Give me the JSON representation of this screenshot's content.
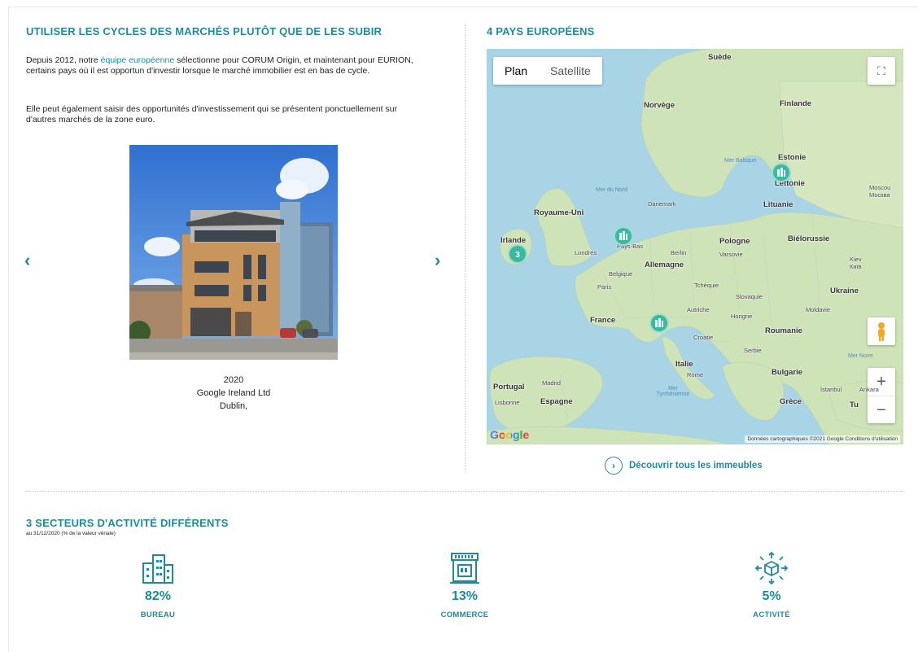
{
  "left": {
    "heading": "UTILISER LES CYCLES DES MARCHÉS PLUTÔT QUE DE LES SUBIR",
    "para1_start": "Depuis 2012, notre ",
    "para1_link": "équipe européenne",
    "para1_end": " sélectionne pour CORUM Origin, et maintenant pour EURION, certains pays où il est opportun d'investir lorsque le marché immobilier est en bas de cycle.",
    "para2": "Elle peut également saisir des opportunités d'investissement qui se présentent ponctuellement sur d'autres marchés de la zone euro.",
    "prev_arrow": "‹",
    "next_arrow": "›",
    "caption": {
      "year": "2020",
      "name": "Google Ireland Ltd",
      "city": "Dublin,"
    }
  },
  "right": {
    "heading": "4 PAYS EUROPÉENS",
    "map": {
      "tab_plan": "Plan",
      "tab_satellite": "Satellite",
      "fullscreen_glyph": "⛶",
      "zoom_in": "+",
      "zoom_out": "−",
      "google_logo": "Google",
      "attribution": "Données cartographiques ©2021 Google   Conditions d'utilisation",
      "labels": {
        "suede": "Suède",
        "norvege": "Norvège",
        "finlande": "Finlande",
        "estonie": "Estonie",
        "lettonie": "Lettonie",
        "lituanie": "Lituanie",
        "mer_baltique": "Mer Baltique",
        "mer_du_nord": "Mer du Nord",
        "danemark": "Danemark",
        "royaume_uni": "Royaume-Uni",
        "irlande": "Irlande",
        "londres": "Londres",
        "pays_bas": "Pays-Bas",
        "berlin": "Berlin",
        "pologne": "Pologne",
        "varsovie": "Varsovie",
        "bielorussie": "Biélorussie",
        "moscou": "Moscou Москва",
        "kiev": "Kiev Київ",
        "allemagne": "Allemagne",
        "belgique": "Belgique",
        "paris": "Paris",
        "tchequie": "Tchéquie",
        "slovaquie": "Slovaquie",
        "ukraine": "Ukraine",
        "autriche": "Autriche",
        "hongrie": "Hongrie",
        "moldavie": "Moldavie",
        "france": "France",
        "croatie": "Croatie",
        "roumanie": "Roumanie",
        "serbie": "Serbie",
        "mer_noire": "Mer Noire",
        "italie": "Italie",
        "rome": "Rome",
        "bulgarie": "Bulgarie",
        "portugal": "Portugal",
        "madrid": "Madrid",
        "lisbonne": "Lisbonne",
        "espagne": "Espagne",
        "mer_tyrrhenienne": "Mer Tyrrhénienne",
        "istanbul": "İstanbul",
        "ankara": "Ankara",
        "grece": "Grèce",
        "turquie": "Tu"
      },
      "cluster_count": "3"
    },
    "discover_label": "Découvrir tous les immeubles"
  },
  "sectors": {
    "heading": "3 SECTEURS D'ACTIVITÉ DIFFÉRENTS",
    "subheading": "au 31/12/2020 (% de la valeur vénale)",
    "items": [
      {
        "icon": "office-buildings-icon",
        "pct": "82%",
        "label": "BUREAU"
      },
      {
        "icon": "storefront-icon",
        "pct": "13%",
        "label": "COMMERCE"
      },
      {
        "icon": "logistics-box-icon",
        "pct": "5%",
        "label": "ACTIVITÉ"
      }
    ]
  },
  "colors": {
    "accent": "#1e8a9c",
    "pin": "#3bb8a0"
  }
}
